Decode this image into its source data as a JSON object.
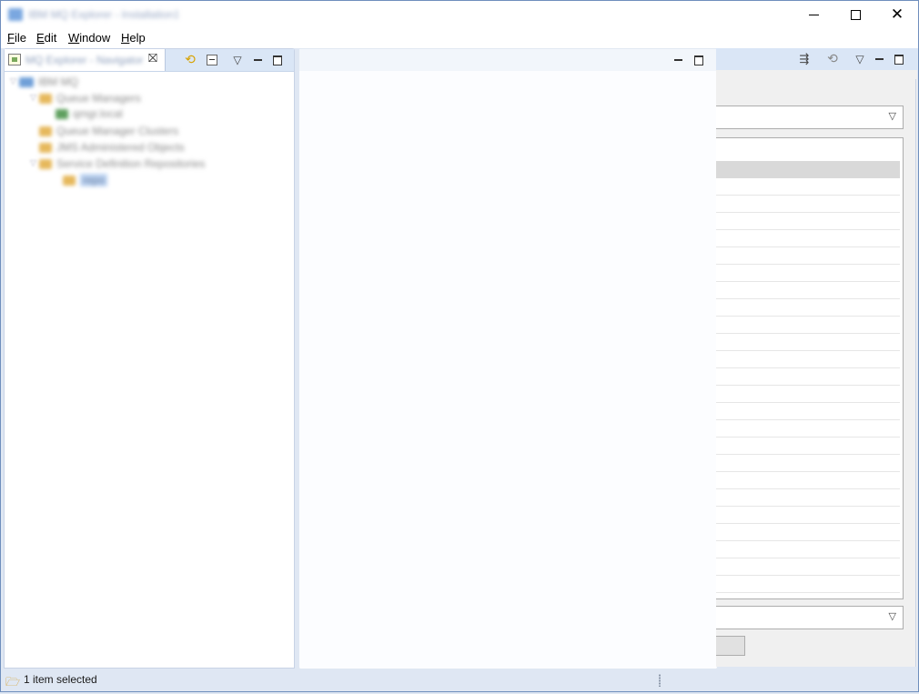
{
  "window": {
    "title": "IBM MQ Explorer - Installation1",
    "controls": {
      "minimize": "minimize",
      "maximize": "maximize",
      "close": "✕"
    }
  },
  "menu": {
    "items": [
      "File",
      "Edit",
      "Window",
      "Help"
    ]
  },
  "navigator": {
    "tab_title": "MQ Explorer - Navigator",
    "close_glyph": "⛝",
    "tree": [
      {
        "label": "IBM MQ",
        "level": 0,
        "icon": "mq-root-icon",
        "color": "#6f9fd8"
      },
      {
        "label": "Queue Managers",
        "level": 1,
        "icon": "folder-icon",
        "color": "#e6b85c"
      },
      {
        "label": "qmgr.local",
        "level": 2,
        "icon": "queue-manager-icon",
        "color": "#5fa05f"
      },
      {
        "label": "Queue Manager Clusters",
        "level": 1,
        "icon": "folder-icon",
        "color": "#e6b85c"
      },
      {
        "label": "JMS Administered Objects",
        "level": 1,
        "icon": "folder-icon",
        "color": "#e6b85c"
      },
      {
        "label": "Service Definition Repositories",
        "level": 1,
        "icon": "folder-icon",
        "color": "#e6b85c"
      },
      {
        "label": "repo",
        "level": 2,
        "icon": "repository-icon",
        "color": "#e6b85c"
      }
    ]
  },
  "status": {
    "text": "1 item selected",
    "icon": "folder-open-icon"
  },
  "colors": {
    "accent": "#dae6f6",
    "selection": "#d9d9d9",
    "status_icon": "#d49a1f"
  }
}
